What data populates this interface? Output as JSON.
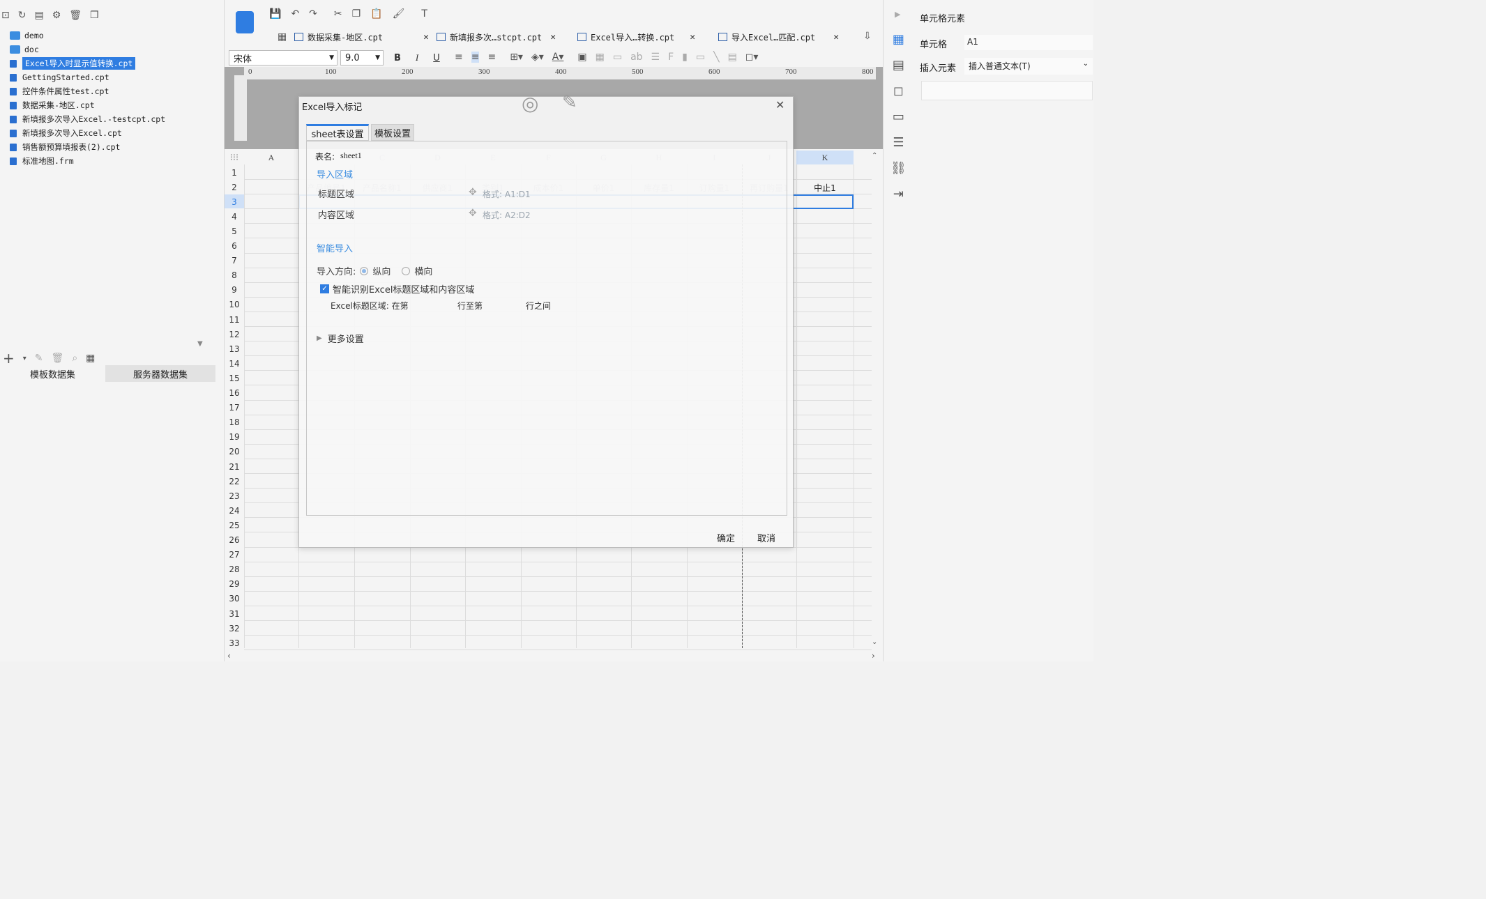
{
  "left": {
    "tree": [
      {
        "label": "demo",
        "type": "folder"
      },
      {
        "label": "doc",
        "type": "folder"
      },
      {
        "label": "Excel导入时显示值转换.cpt",
        "type": "file",
        "selected": true
      },
      {
        "label": "GettingStarted.cpt",
        "type": "file"
      },
      {
        "label": "控件条件属性test.cpt",
        "type": "file"
      },
      {
        "label": "数据采集-地区.cpt",
        "type": "file"
      },
      {
        "label": "新填报多次导入Excel.-testcpt.cpt",
        "type": "file"
      },
      {
        "label": "新填报多次导入Excel.cpt",
        "type": "file"
      },
      {
        "label": "销售额预算填报表(2).cpt",
        "type": "file"
      },
      {
        "label": "标准地图.frm",
        "type": "file"
      }
    ],
    "dataset_tabs": [
      "模板数据集",
      "服务器数据集"
    ]
  },
  "tabs": [
    "数据采集-地区.cpt",
    "新填报多次…stcpt.cpt",
    "Excel导入…转换.cpt",
    "导入Excel…匹配.cpt"
  ],
  "format": {
    "font": "宋体",
    "size": "9.0",
    "bold": "B",
    "italic": "I",
    "underline": "U"
  },
  "ruler": [
    "0",
    "100",
    "200",
    "300",
    "400",
    "500",
    "600",
    "700",
    "800"
  ],
  "columns": [
    "A",
    "C",
    "D",
    "E",
    "F",
    "G",
    "H",
    "I",
    "J",
    "K"
  ],
  "rows": [
    "1",
    "2",
    "3",
    "4",
    "5",
    "6",
    "7",
    "8",
    "9",
    "10",
    "11",
    "12",
    "13",
    "14",
    "15",
    "16",
    "17",
    "18",
    "19",
    "20",
    "21",
    "22",
    "23",
    "24",
    "25",
    "26",
    "27",
    "28",
    "29",
    "30",
    "31",
    "32",
    "33"
  ],
  "row2_cells": [
    "产品编号1",
    "产品名称1",
    "供应商1",
    "类别1",
    "成本价1",
    "单价1",
    "库存量1",
    "订购量1",
    "再订购量1",
    "中止1"
  ],
  "right": {
    "title": "单元格元素",
    "cell_label": "单元格",
    "cell_value": "A1",
    "insert_label": "插入元素",
    "insert_value": "插入普通文本(T)"
  },
  "dialog": {
    "title": "Excel导入标记",
    "tabs": [
      "sheet表设置",
      "模板设置"
    ],
    "sheet_label": "表名:",
    "sheet_value": "sheet1",
    "import_area": "导入区域",
    "title_area": "标题区域",
    "title_format": "格式: A1:D1",
    "content_area": "内容区域",
    "content_format": "格式: A2:D2",
    "smart_import": "智能导入",
    "direction_label": "导入方向:",
    "dir_vertical": "纵向",
    "dir_horizontal": "横向",
    "smart_check": "智能识别Excel标题区域和内容区域",
    "excel_title_range": "Excel标题区域: 在第",
    "row_to": "行至第",
    "row_between": "行之间",
    "more_settings": "更多设置",
    "ok": "确定",
    "cancel": "取消"
  }
}
